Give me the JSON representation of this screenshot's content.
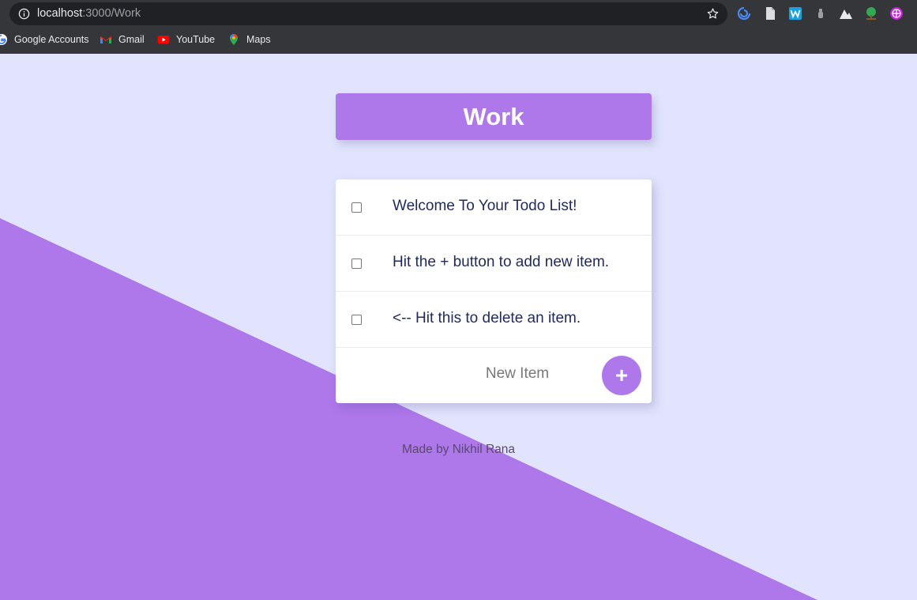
{
  "browser": {
    "url_host": "localhost",
    "url_rest": ":3000/Work",
    "bookmarks": [
      {
        "label": "Google Accounts",
        "icon": "google-icon"
      },
      {
        "label": "Gmail",
        "icon": "gmail-icon"
      },
      {
        "label": "YouTube",
        "icon": "youtube-icon"
      },
      {
        "label": "Maps",
        "icon": "maps-icon"
      }
    ],
    "extensions": [
      "sync-extension-icon",
      "document-extension-icon",
      "w-extension-icon",
      "bottle-extension-icon",
      "mountain-extension-icon",
      "tree-extension-icon",
      "globe-extension-icon"
    ]
  },
  "page": {
    "title": "Work",
    "items": [
      {
        "text": "Welcome To Your Todo List!",
        "checked": false
      },
      {
        "text": "Hit the + button to add new item.",
        "checked": false
      },
      {
        "text": "<-- Hit this to delete an item.",
        "checked": false
      }
    ],
    "new_item_placeholder": "New Item",
    "add_button_label": "+",
    "footer": "Made by Nikhil Rana"
  },
  "colors": {
    "accent": "#AE77EA",
    "background": "#E1E4FC",
    "text": "#1f2a5a"
  }
}
